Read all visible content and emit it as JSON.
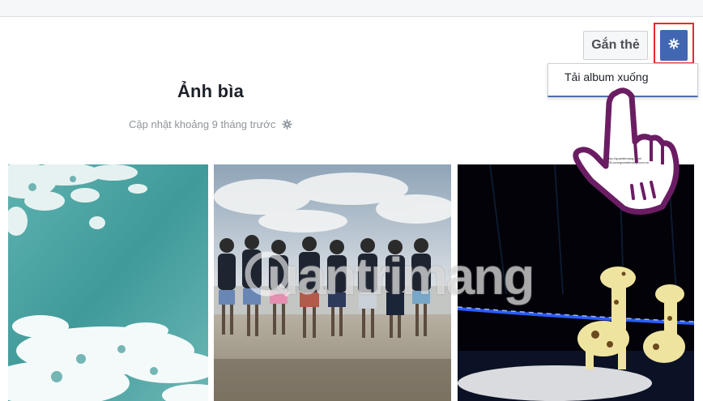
{
  "album": {
    "title": "Ảnh bìa",
    "updated": "Cập nhật khoảng 9 tháng trước"
  },
  "actions": {
    "tag_label": "Gắn thẻ",
    "dropdown_item": "Tải album xuống"
  },
  "icons": {
    "settings": "gear-icon",
    "privacy": "gear-icon"
  },
  "watermark": {
    "text": "uantrimang",
    "hand_caption": "http://quantrimang.com/ FB.com/quantrimang.com.vn"
  },
  "colors": {
    "accent": "#4267b2",
    "highlight": "#e8282d",
    "hand_outline": "#6b1d63"
  }
}
